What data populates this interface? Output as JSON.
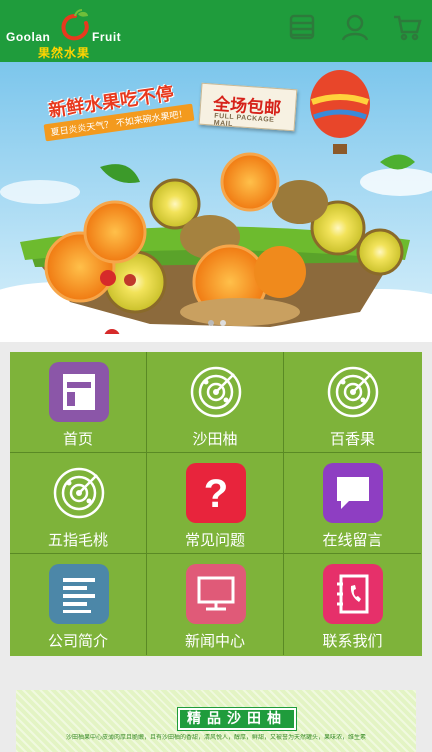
{
  "header": {
    "logo_en_left": "Goolan",
    "logo_en_right": "Fruit",
    "logo_cn": "果然水果",
    "icons": [
      "menu-list-icon",
      "user-icon",
      "cart-icon"
    ]
  },
  "banner": {
    "headline": "新鲜水果吃不停",
    "subline": "夏日炎炎天气？ 不如来碗水果吧！",
    "tag_main": "全场包邮",
    "tag_sub": "FULL PACKAGE MAIL",
    "slides": 2,
    "active_slide": 1
  },
  "nav_grid": {
    "items": [
      {
        "label": "首页",
        "icon": "document-icon",
        "color": "#8b56a8"
      },
      {
        "label": "沙田柚",
        "icon": "radar-icon",
        "color": "#7eb33a"
      },
      {
        "label": "百香果",
        "icon": "radar-icon",
        "color": "#7eb33a"
      },
      {
        "label": "五指毛桃",
        "icon": "radar-icon",
        "color": "#7eb33a"
      },
      {
        "label": "常见问题",
        "icon": "question-icon",
        "color": "#e8243c"
      },
      {
        "label": "在线留言",
        "icon": "chat-bubble-icon",
        "color": "#8e3ec2"
      },
      {
        "label": "公司简介",
        "icon": "text-lines-icon",
        "color": "#4c87a8"
      },
      {
        "label": "新闻中心",
        "icon": "monitor-icon",
        "color": "#e05a78"
      },
      {
        "label": "联系我们",
        "icon": "contact-book-icon",
        "color": "#e6306a"
      }
    ]
  },
  "section": {
    "title": "精品沙田柚",
    "intro": "沙田柚果中心皮薄肉厚且脆嫩，且有沙田柚的香甜，清风悦人，醇厚，鲜甜，又被誉为天然罐头，果味浓，维生素C丰富，常吃对健康有益，果实耐贮藏，被称为天然罐头。"
  },
  "colors": {
    "header_bg": "#1f9c3c",
    "grid_bg": "#7eb33a",
    "page_bg": "#ebebeb",
    "logo_cn": "#ffd400"
  }
}
